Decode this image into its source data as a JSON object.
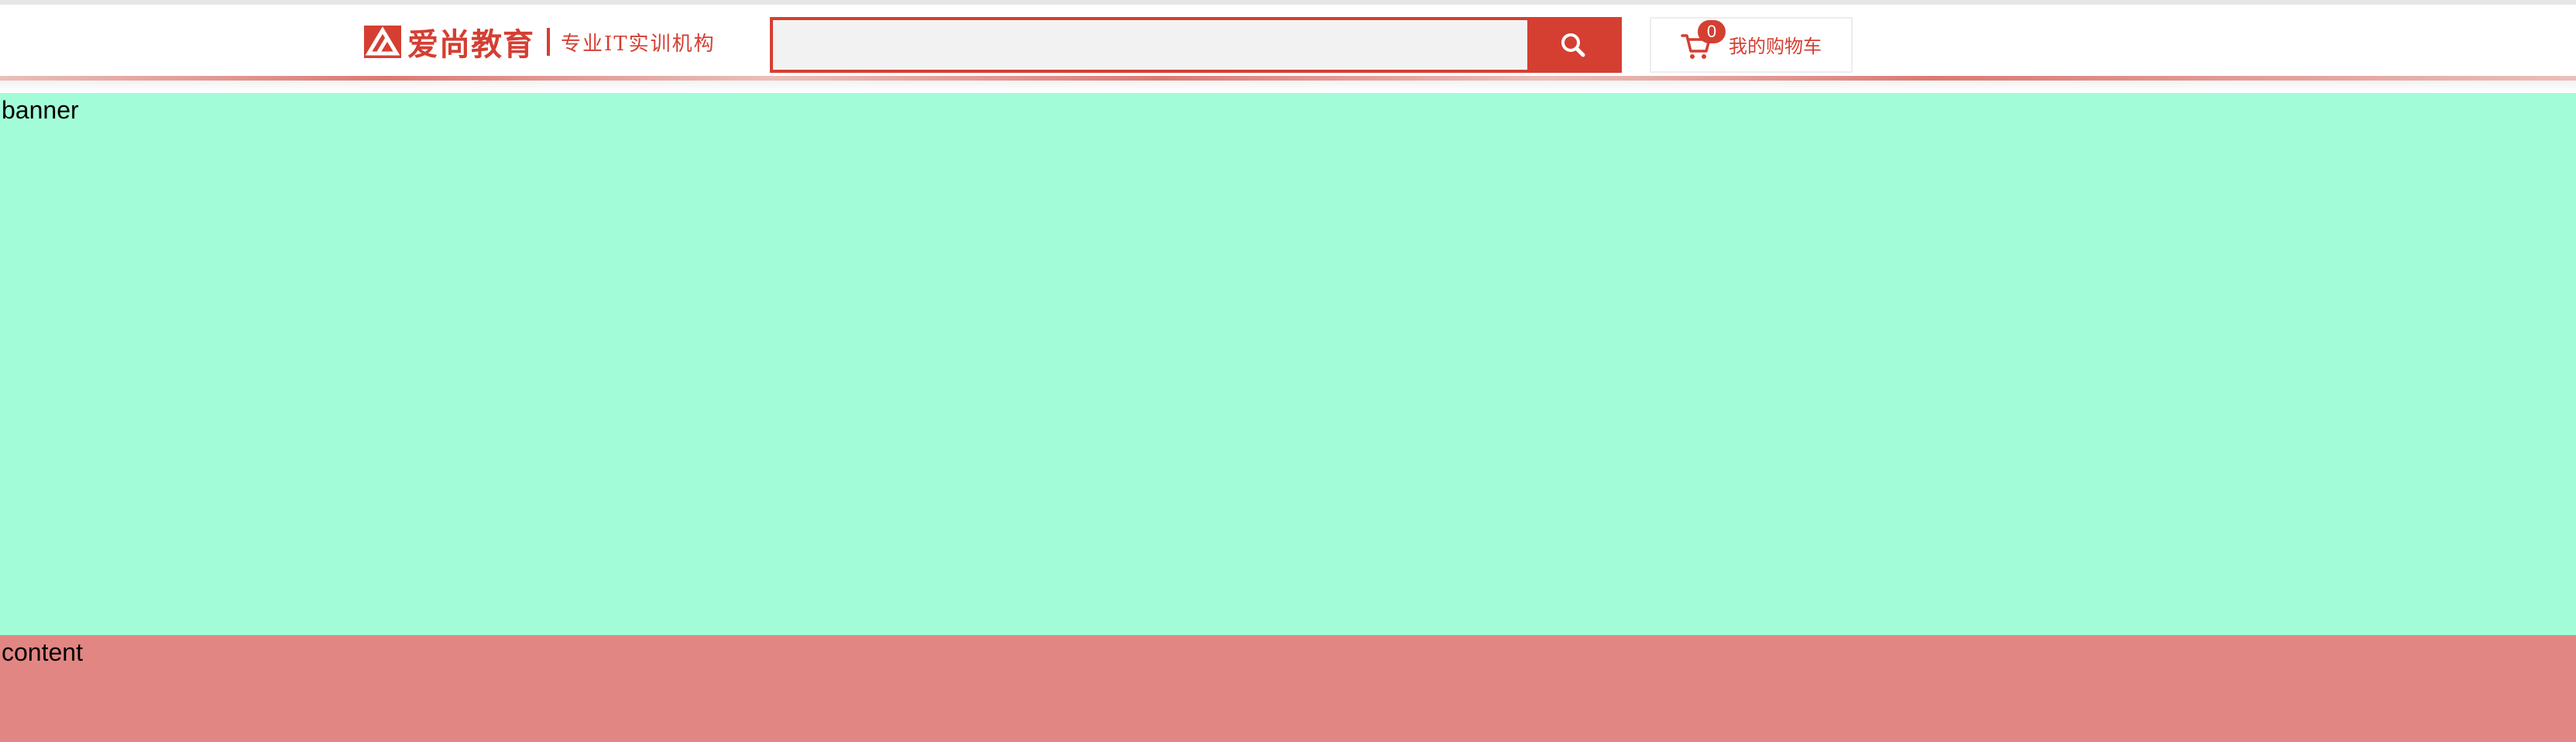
{
  "header": {
    "logo": {
      "brand": "爱尚教育",
      "slogan": "专业IT实训机构",
      "icon": "logo-mark-icon",
      "color": "#d43f32"
    },
    "search": {
      "value": "",
      "placeholder": "",
      "button_icon": "search-icon"
    },
    "cart": {
      "count": "0",
      "label": "我的购物车",
      "icon": "cart-icon"
    }
  },
  "banner": {
    "label": "banner",
    "color": "#a3fcd8"
  },
  "content": {
    "label": "content",
    "color": "#e28683"
  }
}
